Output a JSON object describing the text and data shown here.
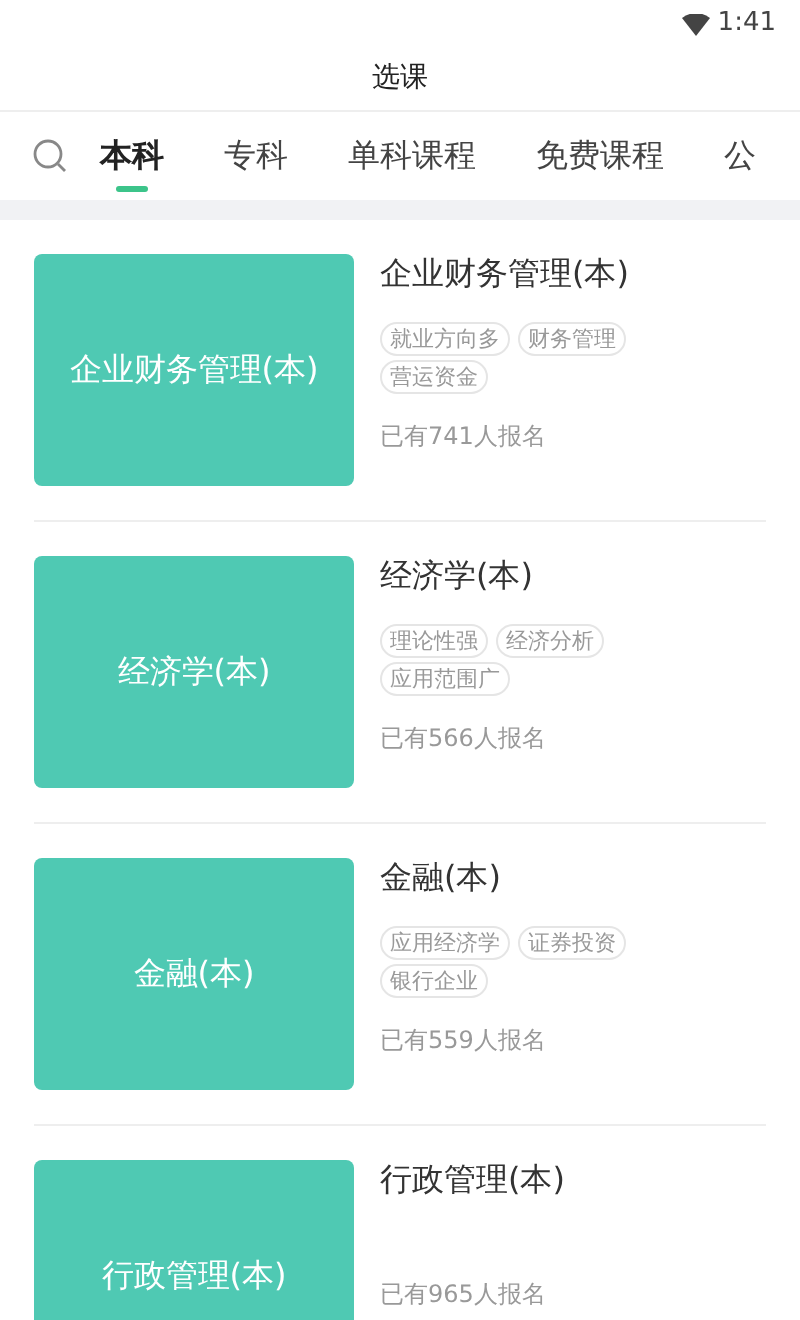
{
  "status_bar": {
    "time": "1:41"
  },
  "header": {
    "title": "选课"
  },
  "tabs": [
    {
      "label": "本科",
      "selected": true
    },
    {
      "label": "专科",
      "selected": false
    },
    {
      "label": "单科课程",
      "selected": false
    },
    {
      "label": "免费课程",
      "selected": false
    },
    {
      "label": "公",
      "selected": false
    }
  ],
  "courses": [
    {
      "cover_text": "企业财务管理(本)",
      "title": "企业财务管理(本)",
      "tags": [
        "就业方向多",
        "财务管理",
        "营运资金"
      ],
      "enrolled": "已有741人报名"
    },
    {
      "cover_text": "经济学(本)",
      "title": "经济学(本)",
      "tags": [
        "理论性强",
        "经济分析",
        "应用范围广"
      ],
      "enrolled": "已有566人报名"
    },
    {
      "cover_text": "金融(本)",
      "title": "金融(本)",
      "tags": [
        "应用经济学",
        "证券投资",
        "银行企业"
      ],
      "enrolled": "已有559人报名"
    },
    {
      "cover_text": "行政管理(本)",
      "title": "行政管理(本)",
      "enrolled": "已有965人报名"
    }
  ]
}
